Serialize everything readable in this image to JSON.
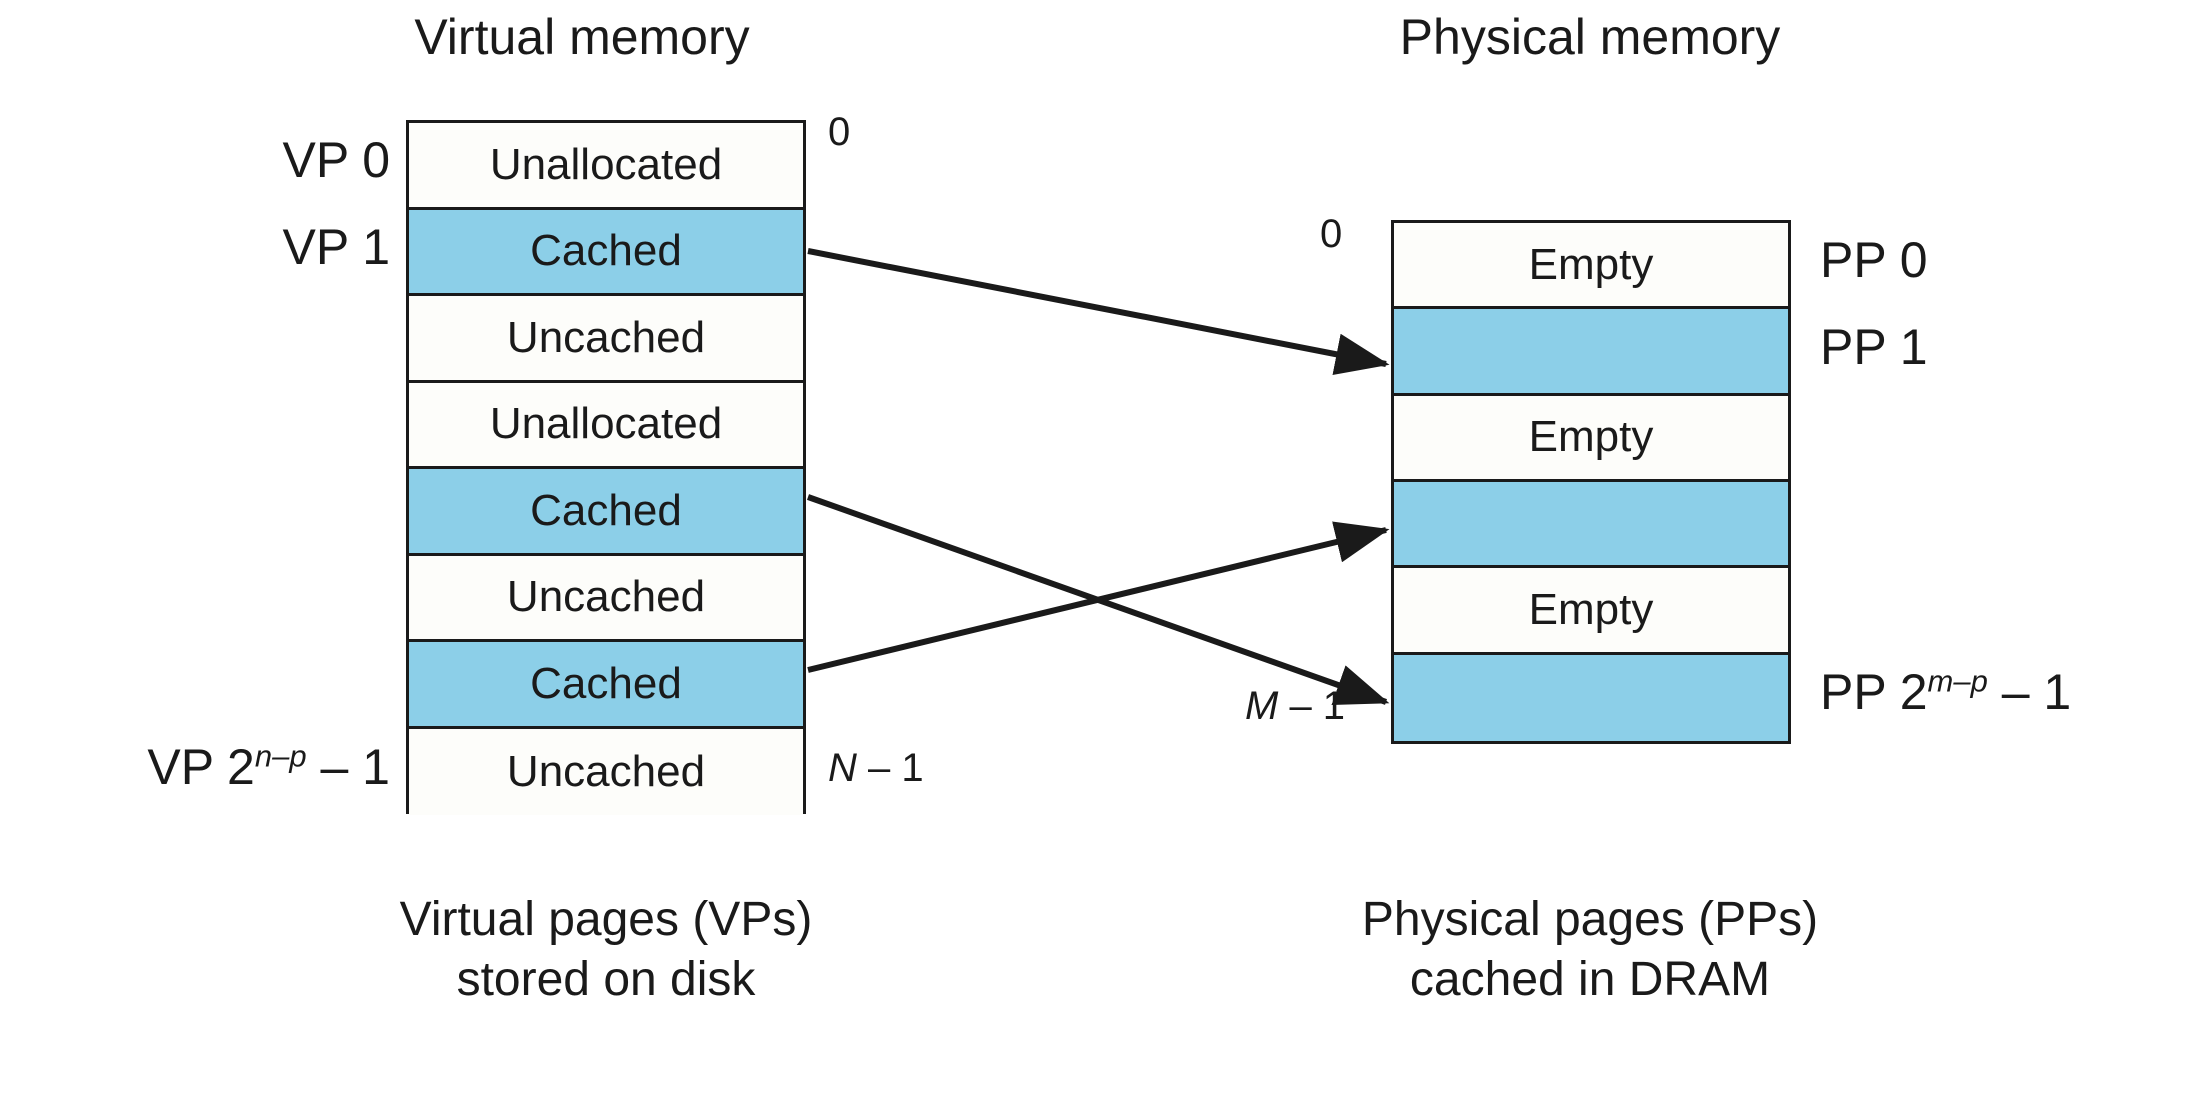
{
  "titles": {
    "virtual": "Virtual memory",
    "physical": "Physical memory"
  },
  "virtual_memory": {
    "rows": [
      {
        "label": "Unallocated",
        "state": "unallocated"
      },
      {
        "label": "Cached",
        "state": "cached"
      },
      {
        "label": "Uncached",
        "state": "uncached"
      },
      {
        "label": "Unallocated",
        "state": "unallocated"
      },
      {
        "label": "Cached",
        "state": "cached"
      },
      {
        "label": "Uncached",
        "state": "uncached"
      },
      {
        "label": "Cached",
        "state": "cached"
      },
      {
        "label": "Uncached",
        "state": "uncached"
      }
    ],
    "left_labels": {
      "first": "VP 0",
      "second": "VP 1",
      "last_prefix": "VP 2",
      "last_exponent": "n–p",
      "last_suffix": " – 1"
    },
    "address_top": "0",
    "address_bottom_var": "N",
    "address_bottom_suffix": " – 1",
    "caption": "Virtual pages (VPs)\nstored on disk"
  },
  "physical_memory": {
    "rows": [
      {
        "label": "Empty",
        "state": "empty"
      },
      {
        "label": "",
        "state": "cached"
      },
      {
        "label": "Empty",
        "state": "empty"
      },
      {
        "label": "",
        "state": "cached"
      },
      {
        "label": "Empty",
        "state": "empty"
      },
      {
        "label": "",
        "state": "cached"
      }
    ],
    "right_labels": {
      "first": "PP 0",
      "second": "PP 1",
      "last_prefix": "PP 2",
      "last_exponent": "m–p",
      "last_suffix": " – 1"
    },
    "address_top": "0",
    "address_bottom_var": "M",
    "address_bottom_suffix": " – 1",
    "caption": "Physical pages (PPs)\ncached in DRAM"
  },
  "mappings": [
    {
      "from_row": 1,
      "to_row": 1
    },
    {
      "from_row": 4,
      "to_row": 5
    },
    {
      "from_row": 6,
      "to_row": 3
    }
  ],
  "colors": {
    "cached_fill": "#8ccfe8",
    "empty_fill": "#fdfdfa",
    "stroke": "#1a1a1a",
    "background": "#ffffff"
  }
}
